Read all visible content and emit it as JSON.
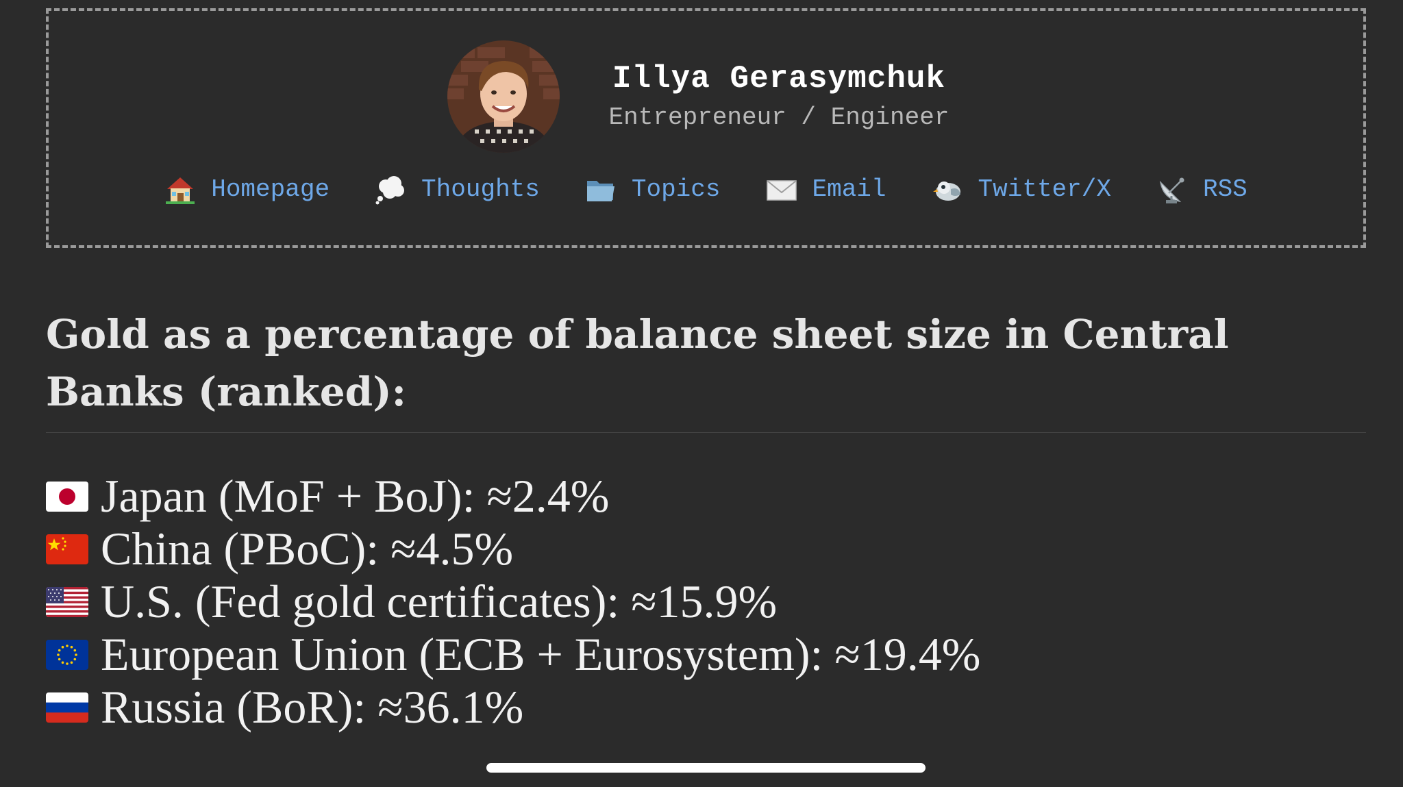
{
  "profile": {
    "name": "Illya Gerasymchuk",
    "role": "Entrepreneur / Engineer"
  },
  "nav": {
    "items": [
      {
        "label": "Homepage",
        "icon": "house-icon"
      },
      {
        "label": "Thoughts",
        "icon": "thought-bubble-icon"
      },
      {
        "label": "Topics",
        "icon": "folder-icon"
      },
      {
        "label": "Email",
        "icon": "envelope-icon"
      },
      {
        "label": "Twitter/X",
        "icon": "bird-icon"
      },
      {
        "label": "RSS",
        "icon": "satellite-antenna-icon"
      }
    ]
  },
  "article": {
    "title": "Gold as a percentage of balance sheet size in Central Banks (ranked):",
    "items": [
      {
        "flag": "japan-flag-icon",
        "text": "Japan (MoF + BoJ): ≈2.4%"
      },
      {
        "flag": "china-flag-icon",
        "text": "China (PBoC): ≈4.5%"
      },
      {
        "flag": "usa-flag-icon",
        "text": "U.S. (Fed gold certificates): ≈15.9%"
      },
      {
        "flag": "eu-flag-icon",
        "text": "European Union (ECB + Eurosystem): ≈19.4%"
      },
      {
        "flag": "russia-flag-icon",
        "text": "Russia (BoR): ≈36.1%"
      }
    ]
  },
  "colors": {
    "background": "#2b2b2b",
    "link": "#6ea8e8",
    "text": "#f2f2f2",
    "muted": "#b9b9b9"
  }
}
